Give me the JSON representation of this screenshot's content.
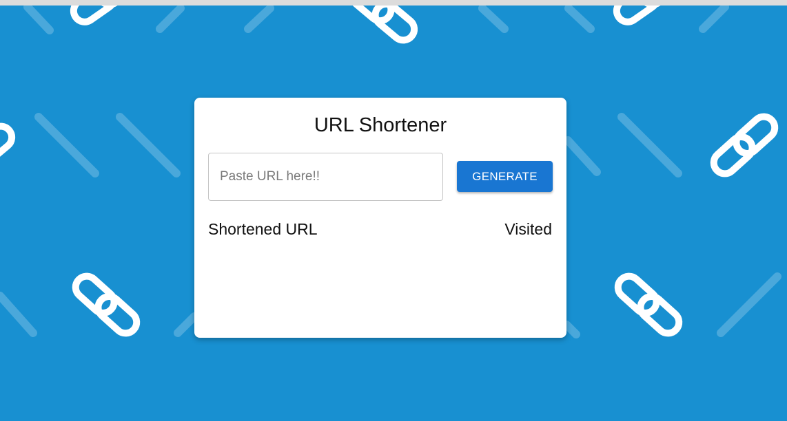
{
  "app": {
    "title": "URL Shortener"
  },
  "form": {
    "url_placeholder": "Paste URL here!!",
    "url_value": "",
    "generate_label": "GENERATE"
  },
  "table": {
    "headers": [
      "Shortened URL",
      "Visited"
    ],
    "rows": []
  },
  "colors": {
    "background": "#1890d1",
    "card": "#ffffff",
    "button": "#1976d2",
    "button_text": "#ffffff",
    "pattern": "#ffffff"
  },
  "icons": {
    "background_icon": "link-chain-icon"
  }
}
